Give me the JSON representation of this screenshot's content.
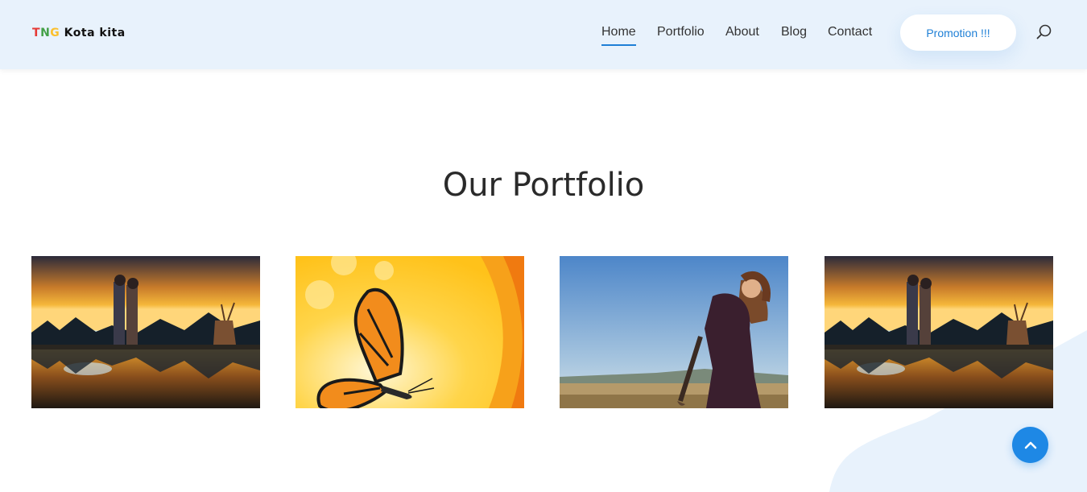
{
  "brand": {
    "part1": "T",
    "part2": "N",
    "part3": "G",
    "rest": " Kota kita"
  },
  "nav": {
    "items": [
      {
        "label": "Home",
        "active": true
      },
      {
        "label": "Portfolio",
        "active": false
      },
      {
        "label": "About",
        "active": false
      },
      {
        "label": "Blog",
        "active": false
      },
      {
        "label": "Contact",
        "active": false
      }
    ],
    "promo_label": "Promotion !!!",
    "search_icon": "search-icon"
  },
  "section": {
    "title": "Our Portfolio"
  },
  "portfolio": [
    {
      "image": "sunset-couple-deer-lake"
    },
    {
      "image": "orange-butterfly-yellow-background"
    },
    {
      "image": "woman-with-guitar-field"
    },
    {
      "image": "sunset-couple-deer-lake"
    }
  ],
  "scroll_top_icon": "chevron-up-icon",
  "colors": {
    "accent": "#1e7fd6",
    "header_bg": "#e8f2fc",
    "button": "#1e88e5"
  }
}
